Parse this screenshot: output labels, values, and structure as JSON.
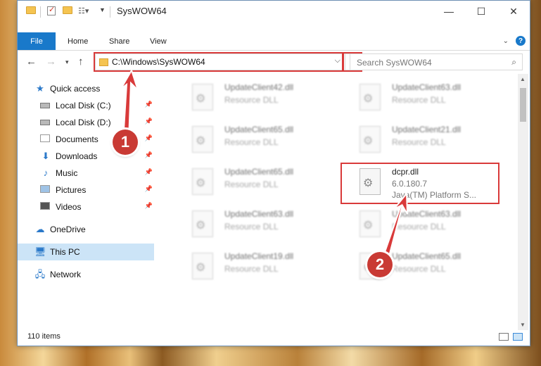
{
  "window": {
    "title": "SysWOW64"
  },
  "ribbon": {
    "file": "File",
    "home": "Home",
    "share": "Share",
    "view": "View",
    "help_label": "?"
  },
  "titlebar": {
    "minimize": "—",
    "maximize": "☐",
    "close": "✕"
  },
  "nav": {
    "address": "C:\\Windows\\SysWOW64",
    "search_placeholder": "Search SysWOW64"
  },
  "sidebar": {
    "items": [
      {
        "label": "Quick access",
        "icon": "star-icon"
      },
      {
        "label": "Local Disk (C:)",
        "icon": "disk-icon"
      },
      {
        "label": "Local Disk (D:)",
        "icon": "disk-icon"
      },
      {
        "label": "Documents",
        "icon": "documents-icon"
      },
      {
        "label": "Downloads",
        "icon": "download-icon"
      },
      {
        "label": "Music",
        "icon": "music-icon"
      },
      {
        "label": "Pictures",
        "icon": "pictures-icon"
      },
      {
        "label": "Videos",
        "icon": "videos-icon"
      },
      {
        "label": "OneDrive",
        "icon": "cloud-icon"
      },
      {
        "label": "This PC",
        "icon": "computer-icon"
      },
      {
        "label": "Network",
        "icon": "network-icon"
      }
    ]
  },
  "files": {
    "left": [
      {
        "name": "UpdateClient42.dll",
        "sub": "Resource DLL"
      },
      {
        "name": "UpdateClient65.dll",
        "sub": "Resource DLL"
      },
      {
        "name": "UpdateClient65.dll",
        "sub": "Resource DLL"
      },
      {
        "name": "UpdateClient63.dll",
        "sub": "Resource DLL"
      },
      {
        "name": "UpdateClient19.dll",
        "sub": "Resource DLL"
      }
    ],
    "right": [
      {
        "name": "UpdateClient63.dll",
        "sub": "Resource DLL"
      },
      {
        "name": "UpdateClient21.dll",
        "sub": "Resource DLL"
      },
      {
        "name": "UpdateClient63.dll",
        "sub": "Resource DLL"
      },
      {
        "name": "UpdateClient65.dll",
        "sub": "Resource DLL"
      }
    ],
    "highlighted": {
      "name": "dcpr.dll",
      "version": "6.0.180.7",
      "description": "Java(TM) Platform S..."
    }
  },
  "status": {
    "count": "110 items"
  },
  "annotations": {
    "badge1": "1",
    "badge2": "2"
  },
  "colors": {
    "accent": "#1979ca",
    "annotation": "#d93a3a"
  }
}
